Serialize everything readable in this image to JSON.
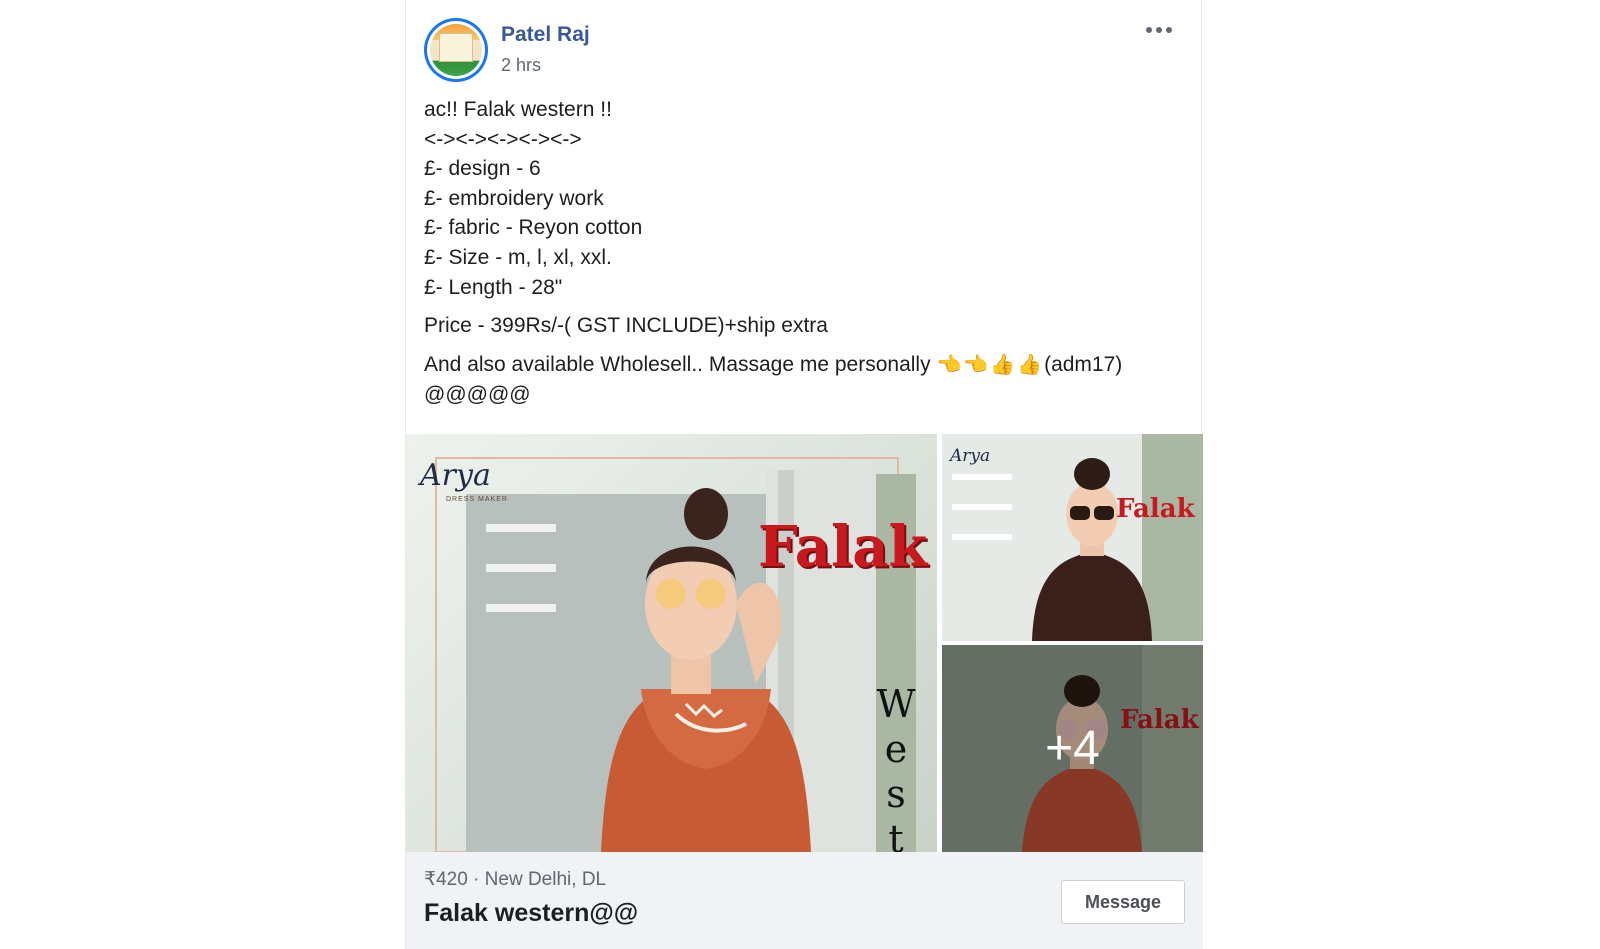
{
  "post": {
    "author": "Patel Raj",
    "time": "2 hrs",
    "more_icon": "more-horizontal-icon",
    "text": {
      "lines": [
        "ac!! Falak western !!",
        "<-><-><-><-><->",
        "£- design - 6",
        "£- embroidery work",
        "£- fabric - Reyon cotton",
        "£- Size - m, l, xl, xxl.",
        "£- Length - 28\""
      ],
      "price_line": "Price - 399Rs/-( GST INCLUDE)+ship extra",
      "wholesale_line": "And also available Wholesell.. Massage me personally",
      "emoji": [
        "👈",
        "👈",
        "👍",
        "👍"
      ],
      "wholesale_suffix": "(adm17)",
      "closing_line": "@@@@@"
    },
    "gallery": {
      "brand": "Arya",
      "brand_sub": "DRESS MAKER",
      "title": "Falak",
      "subtitle_letters": [
        "W",
        "e",
        "s",
        "t"
      ],
      "more_count": "+4"
    },
    "listing": {
      "meta": "₹420 · New Delhi, DL",
      "title": "Falak western@@",
      "message_label": "Message"
    }
  },
  "colors": {
    "author": "#385898",
    "muted": "#606770",
    "footer_bg": "#f0f2f5",
    "accent_red": "#c8191f",
    "avatar_ring": "#1877f2"
  }
}
